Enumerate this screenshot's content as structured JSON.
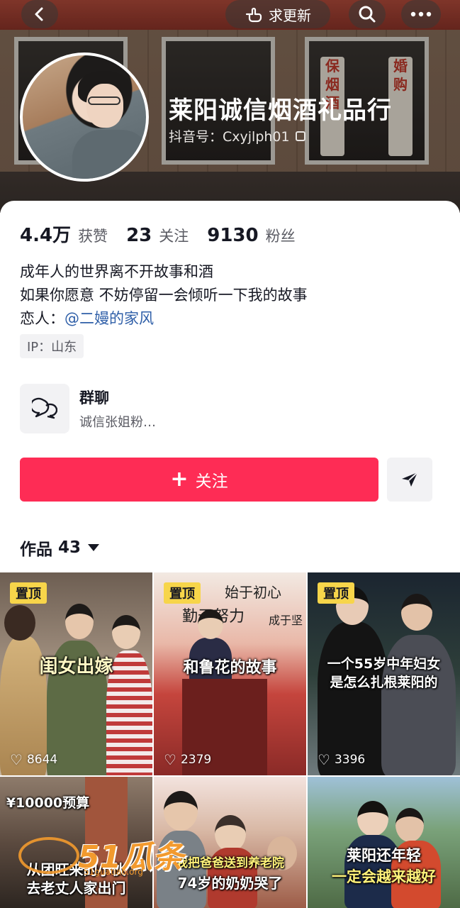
{
  "header": {
    "update_label": "求更新",
    "shop_name": "莱阳诚信烟酒礼品行",
    "douyin_id": "抖音号：Cxyjlph01",
    "cover_poster_left": "保烟酒",
    "cover_poster_right": "婚购"
  },
  "stats": [
    {
      "value": "4.4万",
      "label": "获赞"
    },
    {
      "value": "23",
      "label": "关注"
    },
    {
      "value": "9130",
      "label": "粉丝"
    }
  ],
  "bio": {
    "line1": "成年人的世界离不开故事和酒",
    "line2": "如果你愿意 不妨停留一会倾听一下我的故事",
    "line3_prefix": "恋人：",
    "line3_mention": "@二嫚的家风"
  },
  "ip_tag": "IP：山东",
  "group_chat": {
    "title": "群聊",
    "desc": "诚信张姐粉…"
  },
  "follow_label": "关注",
  "works": {
    "label": "作品",
    "count": "43"
  },
  "videos": [
    {
      "pinned": "置顶",
      "caption": "闺女出嫁",
      "likes": "8644"
    },
    {
      "pinned": "置顶",
      "caption": "和鲁花的故事",
      "likes": "2379",
      "banner1": "始于初心",
      "banner2": "勤于努力",
      "banner3": "成于坚"
    },
    {
      "pinned": "置顶",
      "caption_line1": "一个55岁中年妇女",
      "caption_line2": "是怎么扎根莱阳的",
      "likes": "3396"
    },
    {
      "caption_top": "¥10000预算",
      "caption_line1": "从团旺来的小伙",
      "caption_line2": "去老丈人家出门"
    },
    {
      "caption_line1": "我把爸爸送到养老院",
      "caption_line2": "74岁的奶奶哭了"
    },
    {
      "caption_line1": "莱阳还年轻",
      "caption_line2": "一定会越来越好"
    }
  ],
  "watermark": {
    "brand": "51瓜条",
    "url": "51guatiao.org"
  },
  "colors": {
    "follow_button": "#fe2c55",
    "pin_badge": "#f7d54a",
    "mention": "#2f5fa8"
  }
}
